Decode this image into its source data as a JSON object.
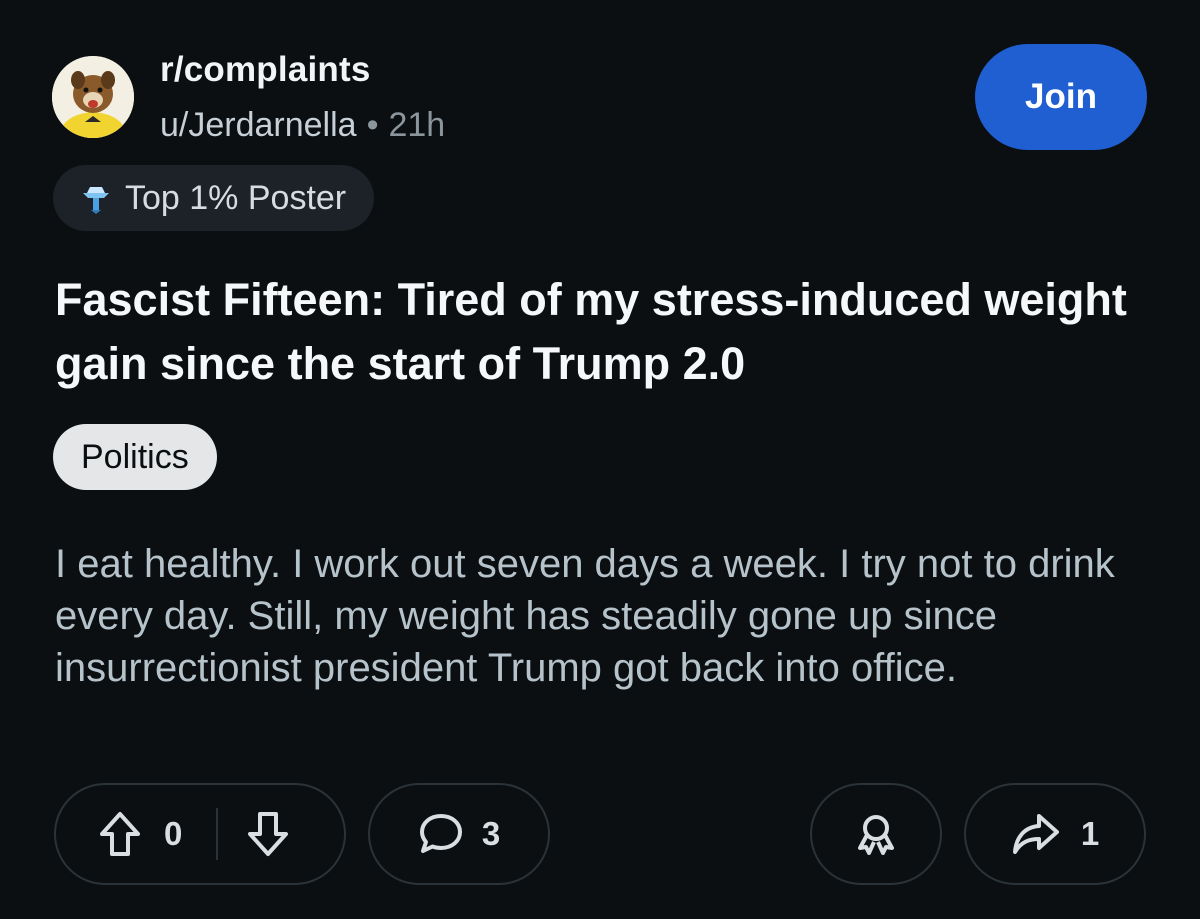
{
  "post": {
    "subreddit": "r/complaints",
    "author": "u/Jerdarnella",
    "separator": "•",
    "time": "21h",
    "join_label": "Join",
    "flair": "Top 1% Poster",
    "title": "Fascist Fifteen: Tired of my stress-induced weight gain since the start of Trump 2.0",
    "tag": "Politics",
    "body": "I eat healthy. I work out seven days a week. I try not to drink every day. Still, my weight has steadily gone up since insurrectionist president Trump got back into office."
  },
  "actions": {
    "vote_count": "0",
    "comment_count": "3",
    "share_count": "1"
  },
  "colors": {
    "background": "#0b0f12",
    "join_button": "#1f5fd1",
    "tag_background": "#e4e6e8",
    "pill_border": "#2b3338"
  },
  "icons": {
    "avatar": "dog-in-yellow-shirt-avatar",
    "flair": "top-poster-badge-icon",
    "upvote": "arrow-up-icon",
    "downvote": "arrow-down-icon",
    "comment": "speech-bubble-icon",
    "award": "award-ribbon-icon",
    "share": "share-arrow-icon"
  }
}
